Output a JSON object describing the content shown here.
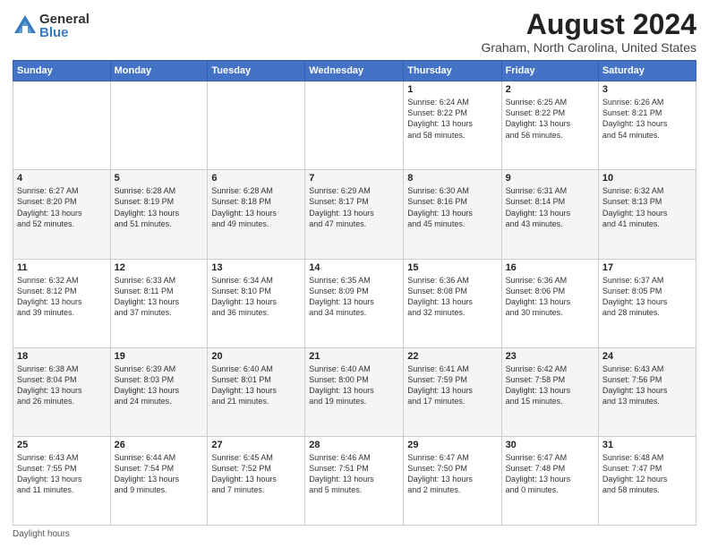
{
  "logo": {
    "general": "General",
    "blue": "Blue"
  },
  "title": "August 2024",
  "subtitle": "Graham, North Carolina, United States",
  "days_of_week": [
    "Sunday",
    "Monday",
    "Tuesday",
    "Wednesday",
    "Thursday",
    "Friday",
    "Saturday"
  ],
  "weeks": [
    [
      {
        "day": "",
        "info": ""
      },
      {
        "day": "",
        "info": ""
      },
      {
        "day": "",
        "info": ""
      },
      {
        "day": "",
        "info": ""
      },
      {
        "day": "1",
        "info": "Sunrise: 6:24 AM\nSunset: 8:22 PM\nDaylight: 13 hours\nand 58 minutes."
      },
      {
        "day": "2",
        "info": "Sunrise: 6:25 AM\nSunset: 8:22 PM\nDaylight: 13 hours\nand 56 minutes."
      },
      {
        "day": "3",
        "info": "Sunrise: 6:26 AM\nSunset: 8:21 PM\nDaylight: 13 hours\nand 54 minutes."
      }
    ],
    [
      {
        "day": "4",
        "info": "Sunrise: 6:27 AM\nSunset: 8:20 PM\nDaylight: 13 hours\nand 52 minutes."
      },
      {
        "day": "5",
        "info": "Sunrise: 6:28 AM\nSunset: 8:19 PM\nDaylight: 13 hours\nand 51 minutes."
      },
      {
        "day": "6",
        "info": "Sunrise: 6:28 AM\nSunset: 8:18 PM\nDaylight: 13 hours\nand 49 minutes."
      },
      {
        "day": "7",
        "info": "Sunrise: 6:29 AM\nSunset: 8:17 PM\nDaylight: 13 hours\nand 47 minutes."
      },
      {
        "day": "8",
        "info": "Sunrise: 6:30 AM\nSunset: 8:16 PM\nDaylight: 13 hours\nand 45 minutes."
      },
      {
        "day": "9",
        "info": "Sunrise: 6:31 AM\nSunset: 8:14 PM\nDaylight: 13 hours\nand 43 minutes."
      },
      {
        "day": "10",
        "info": "Sunrise: 6:32 AM\nSunset: 8:13 PM\nDaylight: 13 hours\nand 41 minutes."
      }
    ],
    [
      {
        "day": "11",
        "info": "Sunrise: 6:32 AM\nSunset: 8:12 PM\nDaylight: 13 hours\nand 39 minutes."
      },
      {
        "day": "12",
        "info": "Sunrise: 6:33 AM\nSunset: 8:11 PM\nDaylight: 13 hours\nand 37 minutes."
      },
      {
        "day": "13",
        "info": "Sunrise: 6:34 AM\nSunset: 8:10 PM\nDaylight: 13 hours\nand 36 minutes."
      },
      {
        "day": "14",
        "info": "Sunrise: 6:35 AM\nSunset: 8:09 PM\nDaylight: 13 hours\nand 34 minutes."
      },
      {
        "day": "15",
        "info": "Sunrise: 6:36 AM\nSunset: 8:08 PM\nDaylight: 13 hours\nand 32 minutes."
      },
      {
        "day": "16",
        "info": "Sunrise: 6:36 AM\nSunset: 8:06 PM\nDaylight: 13 hours\nand 30 minutes."
      },
      {
        "day": "17",
        "info": "Sunrise: 6:37 AM\nSunset: 8:05 PM\nDaylight: 13 hours\nand 28 minutes."
      }
    ],
    [
      {
        "day": "18",
        "info": "Sunrise: 6:38 AM\nSunset: 8:04 PM\nDaylight: 13 hours\nand 26 minutes."
      },
      {
        "day": "19",
        "info": "Sunrise: 6:39 AM\nSunset: 8:03 PM\nDaylight: 13 hours\nand 24 minutes."
      },
      {
        "day": "20",
        "info": "Sunrise: 6:40 AM\nSunset: 8:01 PM\nDaylight: 13 hours\nand 21 minutes."
      },
      {
        "day": "21",
        "info": "Sunrise: 6:40 AM\nSunset: 8:00 PM\nDaylight: 13 hours\nand 19 minutes."
      },
      {
        "day": "22",
        "info": "Sunrise: 6:41 AM\nSunset: 7:59 PM\nDaylight: 13 hours\nand 17 minutes."
      },
      {
        "day": "23",
        "info": "Sunrise: 6:42 AM\nSunset: 7:58 PM\nDaylight: 13 hours\nand 15 minutes."
      },
      {
        "day": "24",
        "info": "Sunrise: 6:43 AM\nSunset: 7:56 PM\nDaylight: 13 hours\nand 13 minutes."
      }
    ],
    [
      {
        "day": "25",
        "info": "Sunrise: 6:43 AM\nSunset: 7:55 PM\nDaylight: 13 hours\nand 11 minutes."
      },
      {
        "day": "26",
        "info": "Sunrise: 6:44 AM\nSunset: 7:54 PM\nDaylight: 13 hours\nand 9 minutes."
      },
      {
        "day": "27",
        "info": "Sunrise: 6:45 AM\nSunset: 7:52 PM\nDaylight: 13 hours\nand 7 minutes."
      },
      {
        "day": "28",
        "info": "Sunrise: 6:46 AM\nSunset: 7:51 PM\nDaylight: 13 hours\nand 5 minutes."
      },
      {
        "day": "29",
        "info": "Sunrise: 6:47 AM\nSunset: 7:50 PM\nDaylight: 13 hours\nand 2 minutes."
      },
      {
        "day": "30",
        "info": "Sunrise: 6:47 AM\nSunset: 7:48 PM\nDaylight: 13 hours\nand 0 minutes."
      },
      {
        "day": "31",
        "info": "Sunrise: 6:48 AM\nSunset: 7:47 PM\nDaylight: 12 hours\nand 58 minutes."
      }
    ]
  ],
  "footer": {
    "label": "Daylight hours"
  }
}
